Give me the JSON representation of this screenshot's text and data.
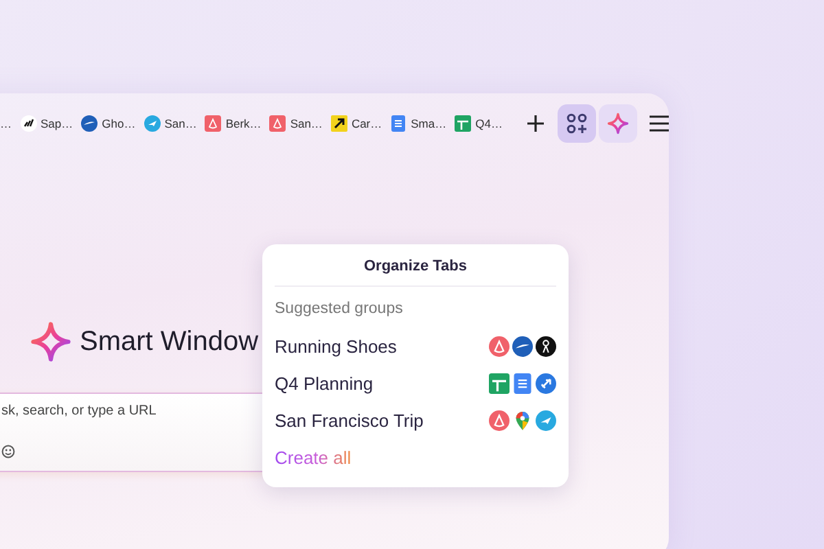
{
  "tabs": [
    {
      "label": "…"
    },
    {
      "label": "Sap…"
    },
    {
      "label": "Gho…"
    },
    {
      "label": "San…"
    },
    {
      "label": "Berk…"
    },
    {
      "label": "San…"
    },
    {
      "label": "Car…"
    },
    {
      "label": "Sma…"
    },
    {
      "label": "Q4…"
    }
  ],
  "toolbar_buttons": [
    {
      "kind": "new-tab",
      "selected": false
    },
    {
      "kind": "organize",
      "selected": true
    },
    {
      "kind": "assistant",
      "selected": false
    },
    {
      "kind": "menu",
      "selected": false
    }
  ],
  "logo": {
    "title": "Smart Window"
  },
  "search": {
    "placeholder": "sk, search, or type a URL"
  },
  "popup": {
    "title": "Organize Tabs",
    "section": "Suggested groups",
    "groups": [
      {
        "name": "Running Shoes"
      },
      {
        "name": "Q4 Planning"
      },
      {
        "name": "San Francisco Trip"
      }
    ],
    "action": "Create all"
  }
}
